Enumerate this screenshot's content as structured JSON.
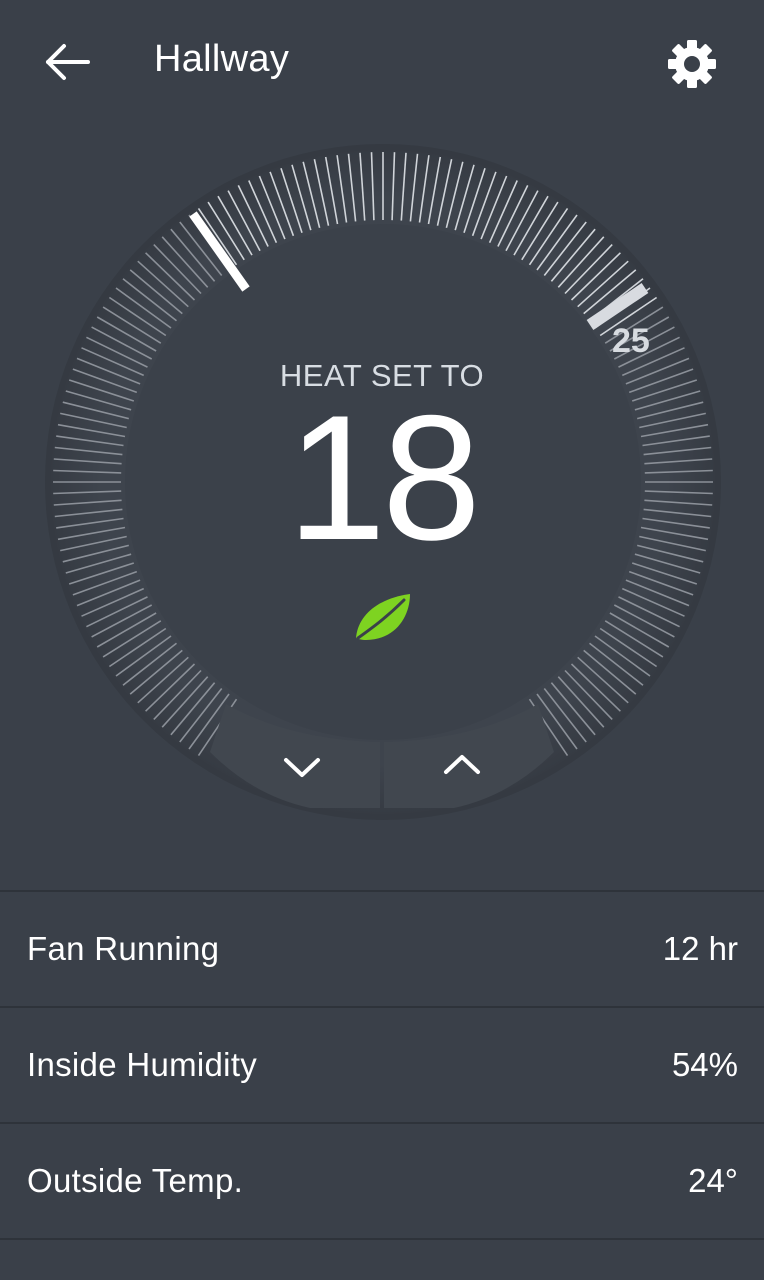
{
  "header": {
    "title": "Hallway",
    "back_icon": "back-arrow-icon",
    "settings_icon": "gear-icon"
  },
  "thermostat": {
    "mode_label": "HEAT SET TO",
    "setpoint": "18",
    "max_label": "25",
    "eco_icon": "leaf-icon",
    "down_icon": "chevron-down-icon",
    "up_icon": "chevron-up-icon",
    "colors": {
      "background": "#3a4049",
      "dial_face": "#3b414a",
      "tick": "#c7ccd2",
      "marker": "#ffffff",
      "leaf": "#7ed321"
    }
  },
  "stats": [
    {
      "label": "Fan Running",
      "value": "12 hr"
    },
    {
      "label": "Inside Humidity",
      "value": "54%"
    },
    {
      "label": "Outside Temp.",
      "value": "24°"
    }
  ]
}
